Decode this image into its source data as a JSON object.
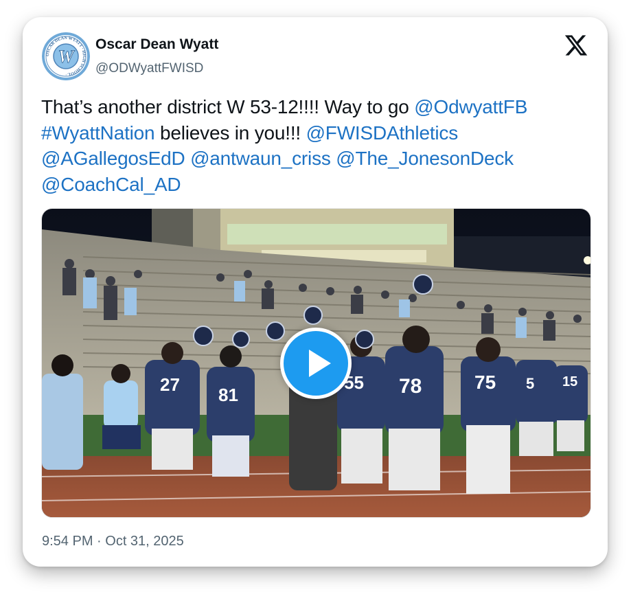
{
  "profile": {
    "display_name": "Oscar Dean Wyatt",
    "handle": "@ODWyattFWISD",
    "avatar_icon": "school-seal-icon",
    "avatar_letter": "W",
    "avatar_ring_text": "OSCAR DEAN WYATT · HIGH SCHOOL ·"
  },
  "tweet": {
    "text_1": "That’s another district W 53-12!!!! Way to go ",
    "mention_1": "@OdwyattFB",
    "hashtag_1": "#WyattNation",
    "text_2": " believes in you!!! ",
    "mention_2": "@FWISDAthletics",
    "mention_3": "@AGallegosEdD",
    "mention_4": "@antwaun_criss",
    "mention_5": "@The_JonesonDeck",
    "mention_6": "@CoachCal_AD"
  },
  "media": {
    "type": "video",
    "play_icon": "play-icon",
    "jersey_numbers": [
      "27",
      "81",
      "55",
      "78",
      "75",
      "15",
      "5"
    ]
  },
  "meta": {
    "timestamp": "9:54 PM · Oct 31, 2025"
  },
  "platform": {
    "logo_icon": "x-logo-icon"
  },
  "colors": {
    "link": "#1d72c4",
    "play": "#1d9bf0",
    "jersey": "#2c3e6b"
  }
}
